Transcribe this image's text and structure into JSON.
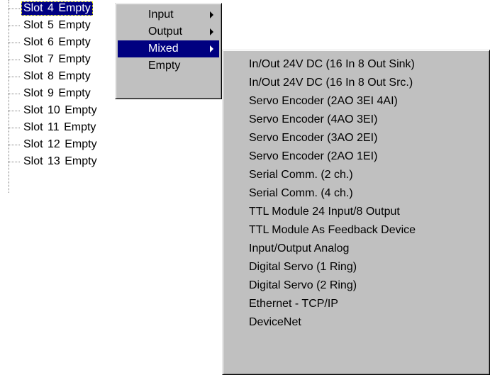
{
  "tree": {
    "items": [
      "Slot  4  Empty",
      "Slot  5  Empty",
      "Slot  6  Empty",
      "Slot  7  Empty",
      "Slot  8  Empty",
      "Slot  9  Empty",
      "Slot 10  Empty",
      "Slot 11  Empty",
      "Slot 12  Empty",
      "Slot 13  Empty"
    ],
    "selected_index": 0
  },
  "context_menu": {
    "items": [
      "Input",
      "Output",
      "Mixed",
      "Empty"
    ],
    "highlighted": "Mixed"
  },
  "submenu": {
    "items": [
      "In/Out 24V DC (16 In 8 Out Sink)",
      "In/Out 24V DC (16 In 8 Out Src.)",
      "Servo Encoder (2AO 3EI 4AI)",
      "Servo Encoder (4AO 3EI)",
      "Servo Encoder (3AO 2EI)",
      "Servo Encoder (2AO 1EI)",
      "Serial Comm. (2 ch.)",
      "Serial Comm. (4 ch.)",
      "TTL Module 24 Input/8 Output",
      "TTL Module As Feedback Device",
      "Input/Output Analog",
      "Digital Servo (1 Ring)",
      "Digital Servo (2 Ring)",
      "Ethernet - TCP/IP",
      "DeviceNet"
    ]
  },
  "colors": {
    "menu_background": "#c0c0c0",
    "highlight": "#000080",
    "highlight_text": "#ffffff"
  },
  "icons": [
    "submenu-arrow-icon"
  ]
}
